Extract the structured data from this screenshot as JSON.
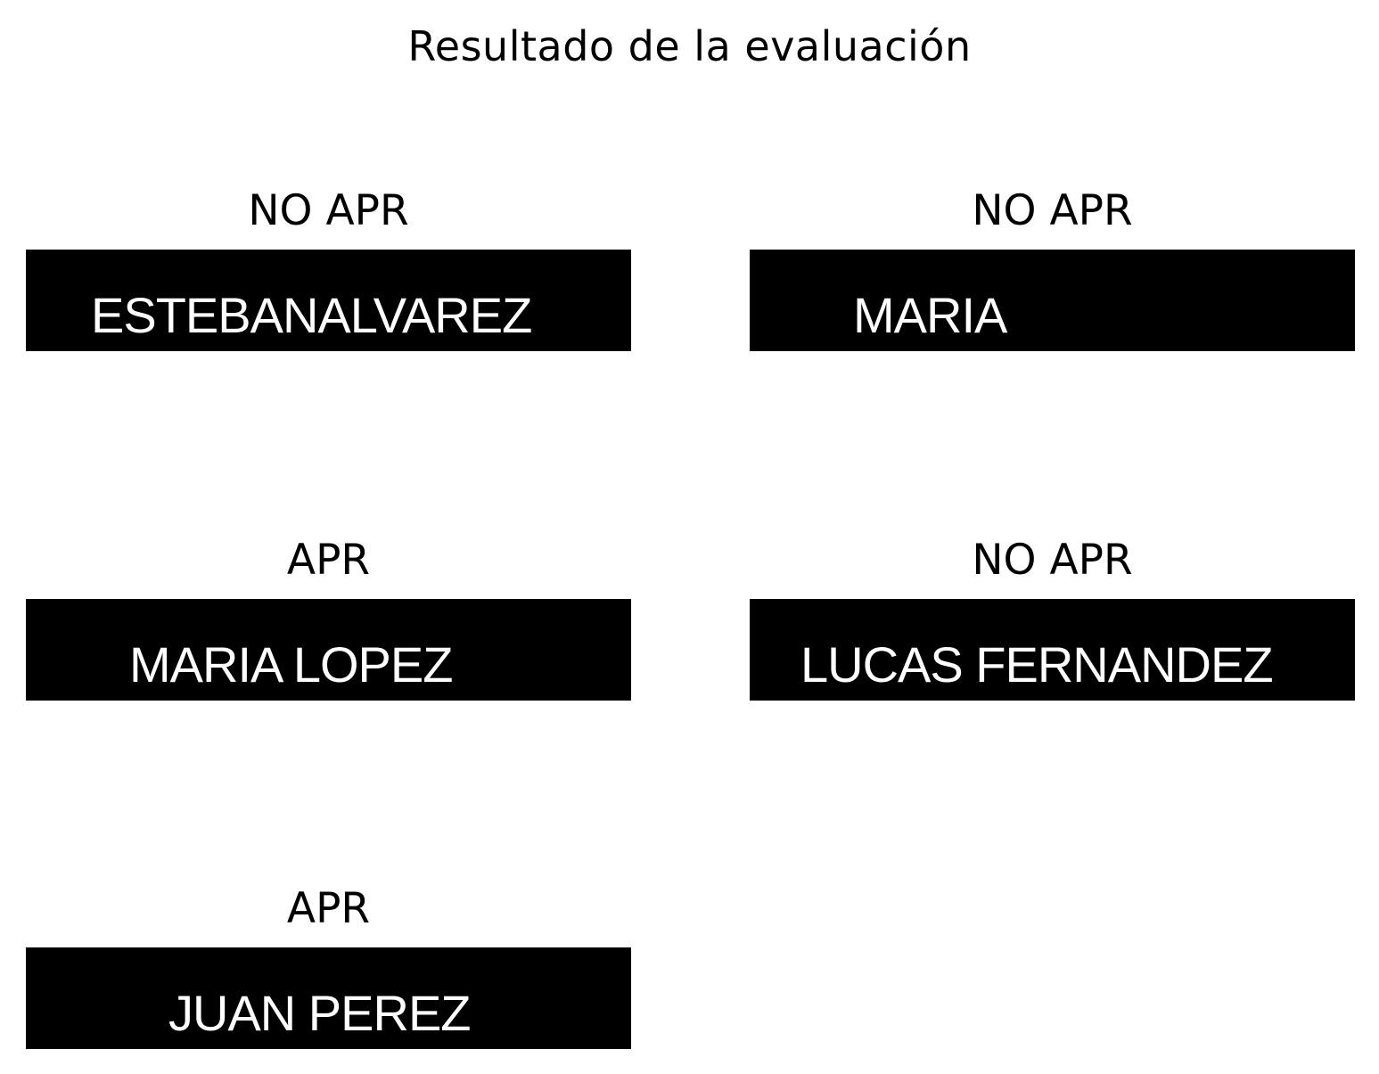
{
  "title": "Resultado de la evaluación",
  "panels": [
    {
      "status": "NO APR",
      "name": "ESTEBANALVAREZ"
    },
    {
      "status": "NO APR",
      "name": "MARIA"
    },
    {
      "status": "APR",
      "name": "MARIA LOPEZ"
    },
    {
      "status": "NO APR",
      "name": "LUCAS FERNANDEZ"
    },
    {
      "status": "APR",
      "name": "JUAN PEREZ"
    }
  ]
}
